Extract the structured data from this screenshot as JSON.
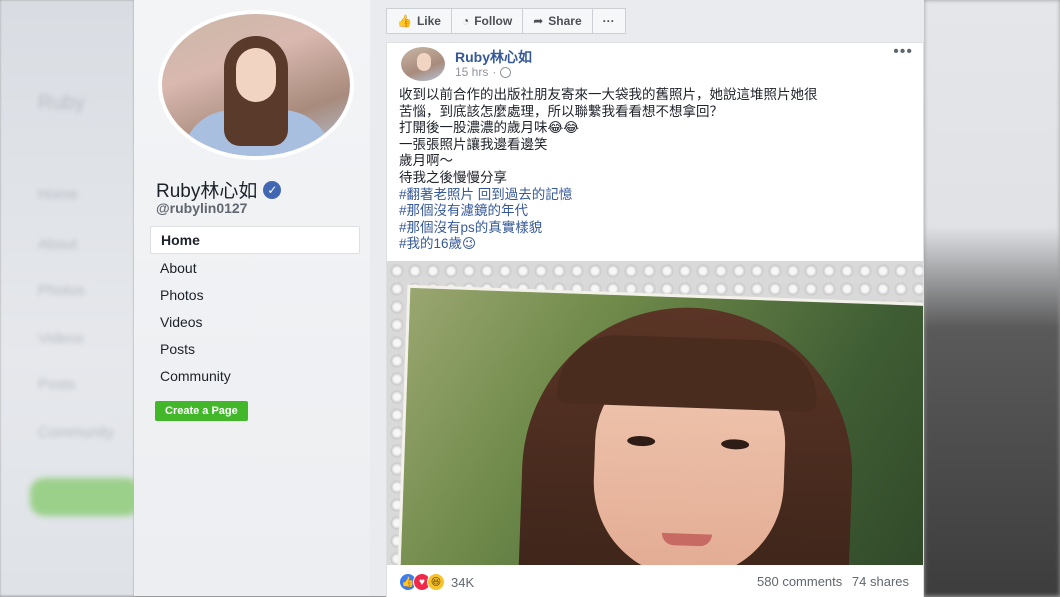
{
  "sidebar": {
    "page_name": "Ruby林心如",
    "handle": "@rubylin0127",
    "nav": [
      {
        "label": "Home",
        "active": true
      },
      {
        "label": "About",
        "active": false
      },
      {
        "label": "Photos",
        "active": false
      },
      {
        "label": "Videos",
        "active": false
      },
      {
        "label": "Posts",
        "active": false
      },
      {
        "label": "Community",
        "active": false
      }
    ],
    "create_page": "Create a Page"
  },
  "actions": {
    "like": "Like",
    "follow": "Follow",
    "share": "Share",
    "more": "···"
  },
  "post": {
    "author": "Ruby林心如",
    "time": "15 hrs",
    "more": "•••",
    "lines": [
      "收到以前合作的出版社朋友寄來一大袋我的舊照片，她說這堆照片她很",
      "苦惱，到底該怎麼處理，所以聯繫我看看想不想拿回？",
      "打開後一股濃濃的歲月味😂😂",
      "一張張照片讓我邊看邊笑",
      "歲月啊～",
      "待我之後慢慢分享"
    ],
    "hashtags": [
      "#翻著老照片 回到過去的記憶",
      "#那個沒有濾鏡的年代",
      "#那個沒有ps的真實樣貌",
      "#我的16歲😉"
    ],
    "reaction_count": "34K",
    "comments": "580 comments",
    "shares": "74 shares"
  },
  "colors": {
    "link": "#365899",
    "green_button": "#42b72a",
    "verified": "#4267b2"
  }
}
